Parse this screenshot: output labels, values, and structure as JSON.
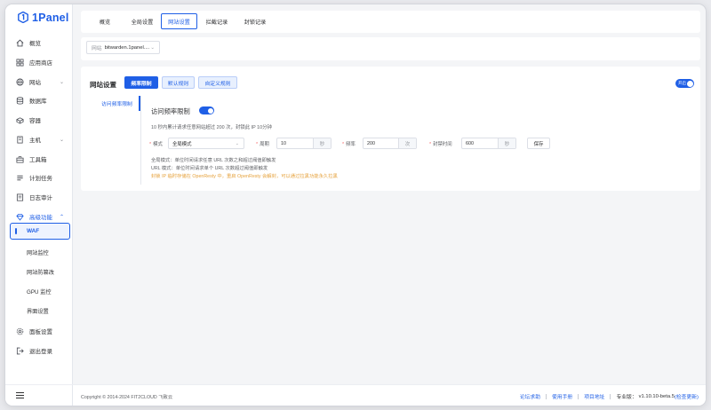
{
  "app": {
    "name": "1Panel"
  },
  "sidebar": {
    "items": [
      {
        "label": "概览",
        "icon": "home-icon"
      },
      {
        "label": "应用商店",
        "icon": "grid-icon"
      },
      {
        "label": "网站",
        "icon": "globe-icon",
        "chevron": "⌄"
      },
      {
        "label": "数据库",
        "icon": "database-icon"
      },
      {
        "label": "容器",
        "icon": "container-icon"
      },
      {
        "label": "主机",
        "icon": "server-icon",
        "chevron": "⌄"
      },
      {
        "label": "工具箱",
        "icon": "toolbox-icon"
      },
      {
        "label": "计划任务",
        "icon": "calendar-icon"
      },
      {
        "label": "日志审计",
        "icon": "log-icon"
      },
      {
        "label": "高级功能",
        "icon": "diamond-icon",
        "chevron": "⌃"
      }
    ],
    "sub_items": [
      "WAF",
      "网站监控",
      "网站防篡改",
      "GPU 监控",
      "界面设置"
    ],
    "bottom_items": [
      {
        "label": "面板设置",
        "icon": "settings-icon"
      },
      {
        "label": "退出登录",
        "icon": "logout-icon"
      }
    ]
  },
  "tabs": [
    "概览",
    "全局设置",
    "网站设置",
    "拦截记录",
    "封锁记录"
  ],
  "active_tab": "网站设置",
  "site_select": {
    "prefix": "网站",
    "value": "bitwarden.1panel...."
  },
  "settings": {
    "title": "网站设置",
    "rule_buttons": [
      "频率限制",
      "默认规则",
      "自定义规则"
    ],
    "global_toggle": "开启",
    "side_nav": "访问频率限制",
    "panel_title": "访问频率限制",
    "description": "10 秒内累计请求任意网站超过 200 次，封锁此 IP 10分钟",
    "form": {
      "mode_label": "模式",
      "mode_value": "全局模式",
      "period_label": "周期",
      "period_value": "10",
      "period_unit": "秒",
      "freq_label": "频率",
      "freq_value": "200",
      "freq_unit": "次",
      "ban_label": "封禁时间",
      "ban_value": "600",
      "ban_unit": "秒",
      "save": "保存"
    },
    "notes": [
      "全局模式：单位时间请求任意 URL 次数之和超过阈值即触发",
      "URL 模式：单位时间请求单个 URL 次数超过阈值即触发",
      "封锁 IP 临时存储在 OpenResty 中，重启 OpenResty 会解封，可以通过拉黑功能永久拉黑"
    ]
  },
  "footer": {
    "copyright": "Copyright © 2014-2024 FIT2CLOUD 飞致云",
    "links": [
      "论坛求助",
      "使用手册",
      "项目地址"
    ],
    "edition": "专业版：",
    "version": "v1.10.10-beta.5",
    "update": "(检查更新)"
  },
  "colors": {
    "accent": "#1f5fe6",
    "warning": "#e6a23c",
    "background": "#f4f5f7"
  }
}
